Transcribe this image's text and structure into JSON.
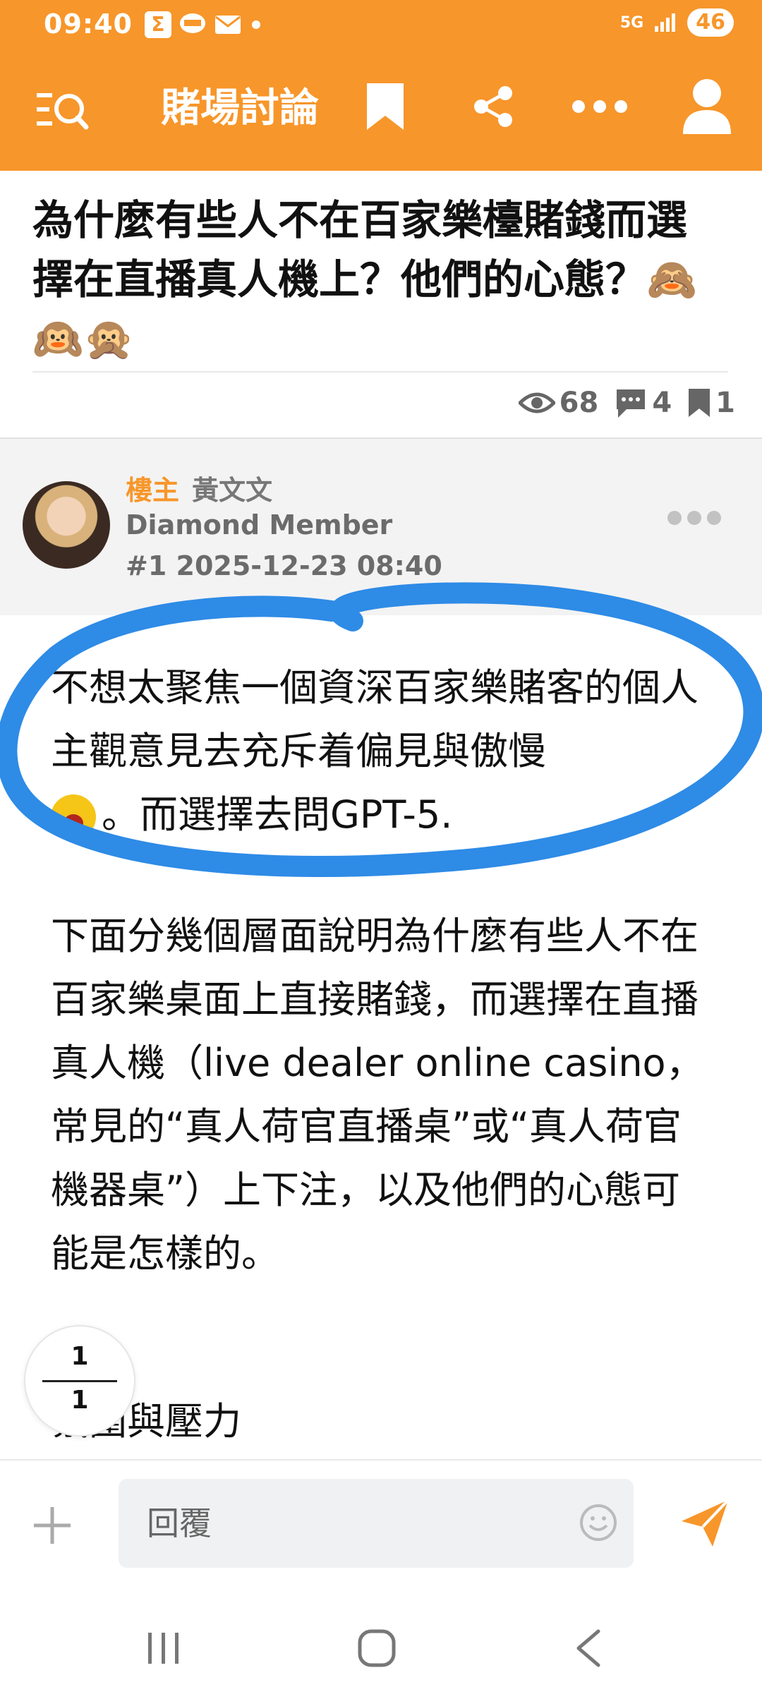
{
  "status_bar": {
    "time": "09:40",
    "notif_box": "Σ",
    "network": "5G",
    "battery": "46"
  },
  "app_bar": {
    "title": "賭場討論",
    "icons": [
      "menu-search-icon",
      "bookmark-icon",
      "share-icon",
      "more-icon",
      "profile-icon"
    ]
  },
  "post": {
    "title": "為什麼有些人不在百家樂檯賭錢而選擇在直播真人機上？他們的心態？🙈🙉🙊",
    "views": "68",
    "comments": "4",
    "bookmarks": "1"
  },
  "author": {
    "badge": "樓主",
    "name": "黃文文",
    "level": "Diamond Member",
    "meta": "#1  2025-12-23 08:40"
  },
  "content": {
    "p1_a": "不想太聚焦一個資深百家樂賭客的個人主觀意見去充斥着偏見與傲慢",
    "p1_b": "。而選擇去問GPT-5.",
    "p2": "下面分幾個層面說明為什麼有些人不在百家樂桌面上直接賭錢，而選擇在直播真人機（live dealer online casino，常見的“真人荷官直播桌”或“真人荷官機器桌”）上下注，以及他們的心態可能是怎樣的。",
    "p3": "氛圍與壓力"
  },
  "page_indicator": {
    "current": "1",
    "total": "1"
  },
  "reply": {
    "placeholder": "回覆"
  },
  "colors": {
    "accent": "#F7962A",
    "annotation": "#2E8BE6"
  }
}
